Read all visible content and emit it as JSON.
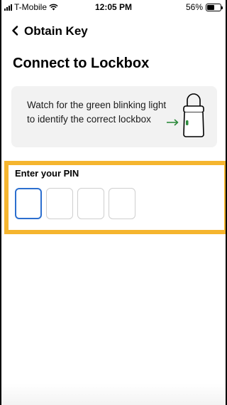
{
  "status_bar": {
    "carrier": "T-Mobile",
    "time": "12:05 PM",
    "battery": "56%",
    "battery_level": 0.56
  },
  "nav": {
    "back_icon": "chevron-left-icon",
    "title": "Obtain Key"
  },
  "page": {
    "heading": "Connect to Lockbox"
  },
  "info_card": {
    "text": "Watch for the green blinking light to identify the correct lockbox",
    "icon": "lockbox-icon",
    "arrow_color": "#2e8b3d",
    "led_color": "#2e8b3d"
  },
  "pin": {
    "label": "Enter your PIN",
    "digits": [
      "",
      "",
      "",
      ""
    ],
    "active_index": 0,
    "highlight_color": "#f5b52e",
    "active_border_color": "#2c6fcf"
  }
}
